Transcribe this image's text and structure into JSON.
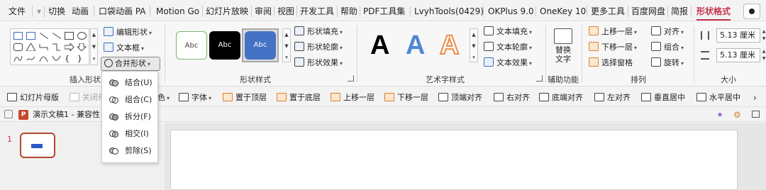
{
  "tabs": [
    {
      "label": "文件",
      "active": false
    },
    {
      "label": "切换",
      "active": false
    },
    {
      "label": "动画",
      "active": false
    },
    {
      "label": "口袋动画 PA",
      "active": false
    },
    {
      "label": "Motion Go",
      "active": false
    },
    {
      "label": "幻灯片放映",
      "active": false
    },
    {
      "label": "审阅",
      "active": false
    },
    {
      "label": "视图",
      "active": false
    },
    {
      "label": "开发工具",
      "active": false
    },
    {
      "label": "帮助",
      "active": false
    },
    {
      "label": "PDF工具集",
      "active": false
    },
    {
      "label": "LvyhTools(0429)",
      "active": false
    },
    {
      "label": "OKPlus 9.0",
      "active": false
    },
    {
      "label": "OneKey 10",
      "active": false
    },
    {
      "label": "更多工具",
      "active": false
    },
    {
      "label": "百度网盘",
      "active": false
    },
    {
      "label": "简报",
      "active": false
    },
    {
      "label": "形状格式",
      "active": true
    }
  ],
  "ribbon": {
    "insert_shapes": {
      "label": "插入形状",
      "edit_shape": "编辑形状",
      "text_box": "文本框",
      "merge_shapes": "合并形状"
    },
    "shape_styles": {
      "label": "形状样式",
      "thumb_text": "Abc",
      "fill": "形状填充",
      "outline": "形状轮廓",
      "effects": "形状效果"
    },
    "art_styles": {
      "label": "艺术字样式",
      "letter": "A",
      "text_fill": "文本填充",
      "text_outline": "文本轮廓",
      "text_effects": "文本效果"
    },
    "accessibility": {
      "label": "辅助功能",
      "alt_text": "替换文字"
    },
    "arrange": {
      "label": "排列",
      "bring_forward": "上移一层",
      "send_backward": "下移一层",
      "selection_pane": "选择窗格",
      "align": "对齐",
      "group": "组合",
      "rotate": "旋转"
    },
    "size": {
      "label": "大小",
      "height": "5.13 厘米",
      "width": "5.13 厘米"
    }
  },
  "quick_toolbar": [
    {
      "label": "幻灯片母版",
      "disabled": false
    },
    {
      "label": "关闭母",
      "disabled": true
    },
    {
      "label": "色",
      "disabled": false
    },
    {
      "label": "字体",
      "disabled": false
    },
    {
      "label": "置于顶层",
      "disabled": false
    },
    {
      "label": "置于底层",
      "disabled": false
    },
    {
      "label": "上移一层",
      "disabled": false
    },
    {
      "label": "下移一层",
      "disabled": false
    },
    {
      "label": "顶端对齐",
      "disabled": false
    },
    {
      "label": "右对齐",
      "disabled": false
    },
    {
      "label": "底端对齐",
      "disabled": false
    },
    {
      "label": "左对齐",
      "disabled": false
    },
    {
      "label": "垂直居中",
      "disabled": false
    },
    {
      "label": "水平居中",
      "disabled": false
    }
  ],
  "doc_tab": {
    "title": "演示文稿1  -  兼容性"
  },
  "slides": [
    {
      "number": "1"
    }
  ],
  "merge_menu": [
    {
      "label": "结合(U)"
    },
    {
      "label": "组合(C)"
    },
    {
      "label": "拆分(F)"
    },
    {
      "label": "相交(I)"
    },
    {
      "label": "剪除(S)"
    }
  ],
  "colors": {
    "accent": "#c4314b",
    "thumb_border": "#b3472a",
    "art_blue": "#4f86d6",
    "art_orange": "#ec8a4a",
    "style_blue": "#4472c4",
    "style_green": "#7cb36b"
  }
}
